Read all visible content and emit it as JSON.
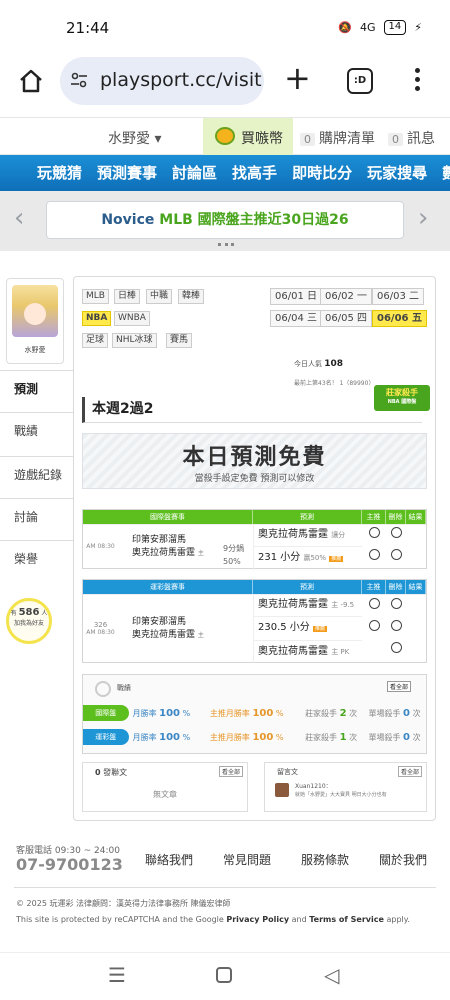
{
  "status_bar": {
    "time": "21:44",
    "signal": "4G",
    "battery": "14"
  },
  "browser": {
    "url": "playsport.cc/visit",
    "tab_count": ":D"
  },
  "userbar": {
    "username": "水野愛",
    "coin_label": "買嗾幣",
    "list_count": "0",
    "list_label": "購牌清單",
    "msg_count": "0",
    "msg_label": "訊息"
  },
  "nav": [
    "玩競猜",
    "預測賽事",
    "討論區",
    "找高手",
    "即時比分",
    "玩家搜尋",
    "數據"
  ],
  "banner": {
    "prefix": "Novice",
    "highlight": "MLB 國際盤主推近30日過26"
  },
  "sidebar": {
    "avatar_name": "水野愛",
    "items": [
      "預測",
      "戰績",
      "遊戲紀錄",
      "討論",
      "榮譽"
    ],
    "bulb_prefix": "有",
    "bulb_count": "586",
    "bulb_unit": "人",
    "bulb_text": "加我為好友"
  },
  "leagues": [
    "MLB",
    "日棒",
    "中職",
    "韓棒",
    "NBA",
    "WNBA",
    "足球",
    "NHL冰球",
    "賽馬"
  ],
  "dates": [
    {
      "md": "06/",
      "d": "01",
      "w": "日"
    },
    {
      "md": "06/",
      "d": "02",
      "w": "一"
    },
    {
      "md": "06/",
      "d": "03",
      "w": "二"
    },
    {
      "md": "06/",
      "d": "04",
      "w": "三"
    },
    {
      "md": "06/",
      "d": "05",
      "w": "四"
    },
    {
      "md": "06/",
      "d": "06",
      "w": "五"
    }
  ],
  "stats": {
    "today_label": "今日人氣",
    "today_value": "108",
    "rank_text": "最前上第43名！ 1（89990）"
  },
  "badge": {
    "title": "莊家殺手",
    "sub": "NBA 國際盤"
  },
  "week": {
    "title": "本週2過2"
  },
  "free": {
    "big": "本日預測免費",
    "small": "當殺手設定免費  預測可以修改"
  },
  "intl_table": {
    "headers": [
      "國際盤賽事",
      "預測",
      "主推",
      "刪除",
      "結果"
    ],
    "time": "AM 08:30",
    "team1": "印第安那溜馬",
    "team2": "奧克拉荷馬雷霆",
    "team2_tag": "主",
    "odds": "9分鍋",
    "pct": "50%",
    "pick1": "奧克拉荷馬雷霆",
    "pick1_note": "讓分",
    "pick2": "231 小分",
    "pick2_note": "贏50%",
    "tag": "推薦"
  },
  "op_table": {
    "headers": [
      "運彩盤賽事",
      "預測",
      "主推",
      "刪除",
      "結果"
    ],
    "num": "326",
    "time": "AM 08:30",
    "team1": "印第安那溜馬",
    "team2": "奧克拉荷馬雷霆",
    "team2_tag": "主",
    "pick1": "奧克拉荷馬雷霆",
    "pick1_note": "主 -9.5",
    "pick2": "230.5 小分",
    "pick3": "奧克拉荷馬雷霆",
    "pick3_note": "主 PK",
    "tag": "推薦"
  },
  "record": {
    "title": "戰績",
    "all": "看全部",
    "rows": [
      {
        "label": "國際盤",
        "w1": "月勝率",
        "v1": "100",
        "u1": "%",
        "w2": "主推月勝率",
        "v2": "100",
        "u2": "%",
        "w3": "莊家殺手",
        "v3": "2",
        "u3": "次",
        "w4": "單場殺手",
        "v4": "0",
        "u4": "次"
      },
      {
        "label": "運彩盤",
        "w1": "月勝率",
        "v1": "100",
        "u1": "%",
        "w2": "主推月勝率",
        "v2": "100",
        "u2": "%",
        "w3": "莊家殺手",
        "v3": "1",
        "u3": "次",
        "w4": "單場殺手",
        "v4": "0",
        "u4": "次"
      }
    ],
    "colors": {
      "intl": "#5cbf1e",
      "op": "#1e96d6"
    }
  },
  "articles": {
    "count": "0",
    "label": "發聯文",
    "all": "看全部",
    "empty": "無文章"
  },
  "guestbook": {
    "label": "留言文",
    "all": "看全部",
    "user": "Xuan1210：",
    "text": "就她「水野愛」大大寶貝 明日大小分也有"
  },
  "footer": {
    "tel_label": "客服電話 09:30 ~ 24:00",
    "tel": "07-9700123",
    "links": [
      "聯絡我們",
      "常見問題",
      "服務條款",
      "關於我們"
    ],
    "copy": "© 2025 玩運彩  法律顧問：漢英得力法律事務所 陳儀宏律師",
    "recaptcha_a": "This site is protected by reCAPTCHA and the Google",
    "privacy": "Privacy Policy",
    "and": "and",
    "terms": "Terms of Service",
    "apply": "apply."
  }
}
